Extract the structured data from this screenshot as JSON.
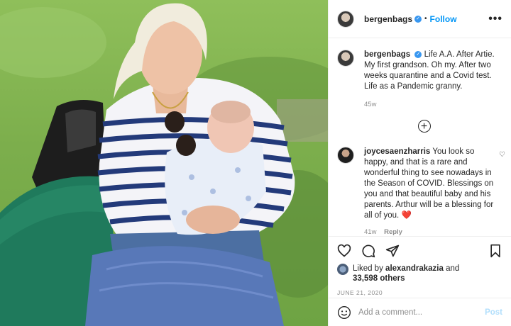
{
  "header": {
    "username": "bergenbags",
    "verified_glyph": "✓",
    "separator": "•",
    "follow_label": "Follow",
    "more_glyph": "•••"
  },
  "caption": {
    "username": "bergenbags",
    "text": "Life A.A. After Artie. My first grandson. Oh my. After two weeks quarantine and a Covid test. Life as a Pandemic granny.",
    "time": "45w"
  },
  "load_more_glyph": "+",
  "comment": {
    "username": "joycesaenzharris",
    "text": "You look so happy, and that is a rare and wonderful thing to see nowadays in the Season of COVID. Blessings on you and that beautiful baby and his parents. Arthur will be a blessing for all of you.",
    "emoji": "❤️",
    "time": "41w",
    "reply_label": "Reply",
    "like_glyph": "♡"
  },
  "likes": {
    "prefix": "Liked by",
    "liker": "alexandrakazia",
    "and": "and",
    "others": "33,598 others"
  },
  "date": "JUNE 21, 2020",
  "add_comment": {
    "placeholder": "Add a comment...",
    "post_label": "Post"
  },
  "colors": {
    "accent": "#0095f6",
    "verified": "#3897f0",
    "muted": "#8e8e8e",
    "heart_red": "#ed4956"
  },
  "icons": [
    "more-icon",
    "verified-icon",
    "load-more-icon",
    "heart-icon",
    "comment-icon",
    "share-icon",
    "bookmark-icon",
    "emoji-icon"
  ]
}
